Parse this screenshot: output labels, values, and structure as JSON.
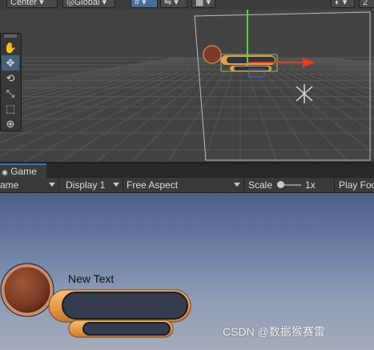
{
  "scene_toolbar": {
    "pivot_label": "Center",
    "space_label": "Global",
    "grid_snap_label": "#",
    "gizmo_label": "2"
  },
  "scene_tools": {
    "items": [
      {
        "name": "hand-tool",
        "glyph": "✋"
      },
      {
        "name": "move-tool",
        "glyph": "✥"
      },
      {
        "name": "rotate-tool",
        "glyph": "⟲"
      },
      {
        "name": "scale-tool",
        "glyph": "⤡"
      },
      {
        "name": "rect-tool",
        "glyph": "⬚"
      },
      {
        "name": "transform-tool",
        "glyph": "⊕"
      }
    ],
    "active_index": 1
  },
  "game_tab": {
    "label": "Game"
  },
  "game_toolbar": {
    "mode_label": "ame",
    "display_label": "Display 1",
    "aspect_label": "Free Aspect",
    "scale_label": "Scale",
    "scale_value": "1x",
    "play_label": "Play Foc"
  },
  "game_view": {
    "ui_text": "New Text",
    "watermark": "CSDN @数据猴赛雷"
  },
  "colors": {
    "axis_x": "#e0401c",
    "axis_y": "#5ad144",
    "accent_tab": "#3a79bb",
    "bar_orange": "#e79c4a",
    "bar_dark": "#343c4d",
    "circle_brown": "#7a3a24"
  }
}
